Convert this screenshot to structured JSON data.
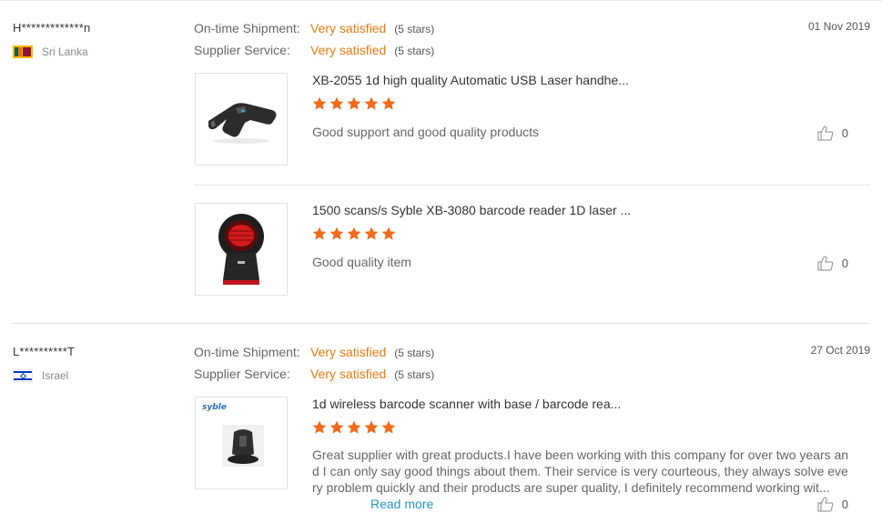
{
  "reviews": [
    {
      "user": "H*************n",
      "country": "Sri Lanka",
      "date": "01 Nov 2019",
      "ratings": [
        {
          "label": "On-time Shipment:",
          "value": "Very satisfied",
          "stars_text": "(5 stars)"
        },
        {
          "label": "Supplier Service:",
          "value": "Very satisfied",
          "stars_text": "(5 stars)"
        }
      ],
      "products": [
        {
          "title": "XB-2055 1d high quality Automatic USB Laser handhe...",
          "rating": 5,
          "comment": "Good support and good quality products",
          "likes": "0"
        },
        {
          "title": "1500 scans/s Syble XB-3080 barcode reader 1D laser ...",
          "rating": 5,
          "comment": "Good quality item",
          "likes": "0"
        }
      ]
    },
    {
      "user": "L**********T",
      "country": "Israel",
      "date": "27 Oct 2019",
      "ratings": [
        {
          "label": "On-time Shipment:",
          "value": "Very satisfied",
          "stars_text": "(5 stars)"
        },
        {
          "label": "Supplier Service:",
          "value": "Very satisfied",
          "stars_text": "(5 stars)"
        }
      ],
      "products": [
        {
          "title": "1d wireless barcode scanner with base / barcode rea...",
          "rating": 5,
          "comment": "Great supplier with great products.I have been working with this company for over two years and I can only say good things about them. Their service is very courteous, they always solve every problem quickly and their products are super quality, I definitely recommend working wit...",
          "read_more": "Read more",
          "brand_logo": "syble",
          "likes": "0"
        }
      ]
    }
  ],
  "colors": {
    "accent": "#e8790f",
    "star": "#f06a1a",
    "link": "#2a95c9"
  },
  "icons": {
    "like": "thumbs-up-icon",
    "star": "star-icon"
  }
}
